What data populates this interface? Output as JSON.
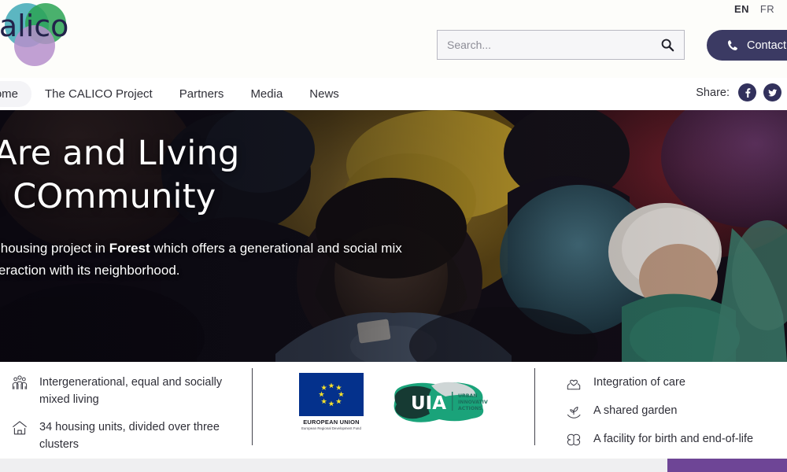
{
  "site": {
    "brand_name": "calico",
    "brand_colors": {
      "teal": "#4fb8b9",
      "green": "#2fa856",
      "purple": "#b08cc4",
      "navy": "#2e2d52"
    }
  },
  "header": {
    "language": {
      "active": "EN",
      "other": "FR"
    },
    "search": {
      "value": "",
      "placeholder": "Search...",
      "icon": "search-icon"
    },
    "contact_button": {
      "label": "Contact",
      "icon": "phone-icon",
      "color": "#3b3a63"
    }
  },
  "nav": {
    "items": [
      {
        "label": "Home",
        "active": true
      },
      {
        "label": "The CALICO Project",
        "active": false
      },
      {
        "label": "Partners",
        "active": false
      },
      {
        "label": "Media",
        "active": false
      },
      {
        "label": "News",
        "active": false
      }
    ],
    "share": {
      "label": "Share:",
      "networks": [
        {
          "name": "facebook-icon"
        },
        {
          "name": "twitter-icon"
        }
      ]
    }
  },
  "hero": {
    "title": "CAre and LIving\nIn COmmunity",
    "subtitle_before": "A co-housing project in ",
    "subtitle_bold": "Forest",
    "subtitle_after": " which offers a generational and social mix in interaction with its neighborhood."
  },
  "features": {
    "left": [
      {
        "icon": "group-people-icon",
        "text": "Intergenerational, equal and socially mixed living"
      },
      {
        "icon": "house-icon",
        "text": "34 housing units, divided over three clusters"
      }
    ],
    "right": [
      {
        "icon": "hands-heart-icon",
        "text": "Integration of care"
      },
      {
        "icon": "sprout-hand-icon",
        "text": "A shared garden"
      },
      {
        "icon": "butterfly-icon",
        "text": "A facility for birth and end-of-life"
      }
    ],
    "logos": {
      "eu": {
        "name": "EUROPEAN UNION",
        "subtitle": "European Regional Development Fund"
      },
      "uia": {
        "abbr": "UIA",
        "line1": "URBAN",
        "line2": "INNOVATIVE",
        "line3": "ACTIONS"
      }
    }
  },
  "footer": {
    "accent_color": "#6e4596"
  }
}
